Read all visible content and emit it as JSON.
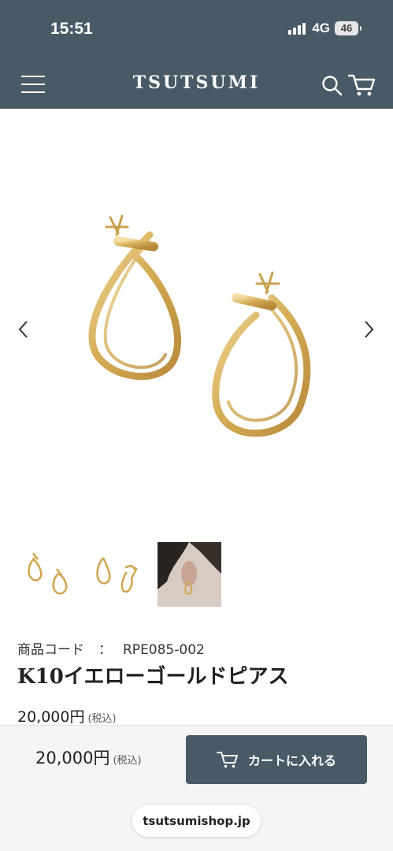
{
  "status_bar": {
    "time": "15:51",
    "network": "4G",
    "battery": "46"
  },
  "header": {
    "brand": "TSUTSUMI"
  },
  "icons": {
    "menu": "hamburger-icon",
    "search": "search-icon",
    "cart": "cart-icon",
    "prev": "chevron-left-icon",
    "next": "chevron-right-icon"
  },
  "colors": {
    "header_bg": "#475a66",
    "gold": "#d9b25c",
    "button_bg": "#475a66"
  },
  "product": {
    "code_label": "商品コード",
    "code_separator": "：",
    "code": "RPE085-002",
    "name": "K10イエローゴールドピアス",
    "price": "20,000円",
    "tax_note": "(税込)"
  },
  "bottom_bar": {
    "price": "20,000円",
    "tax_note": "(税込)",
    "add_to_cart": "カートに入れる",
    "url": "tsutsumishop.jp"
  }
}
